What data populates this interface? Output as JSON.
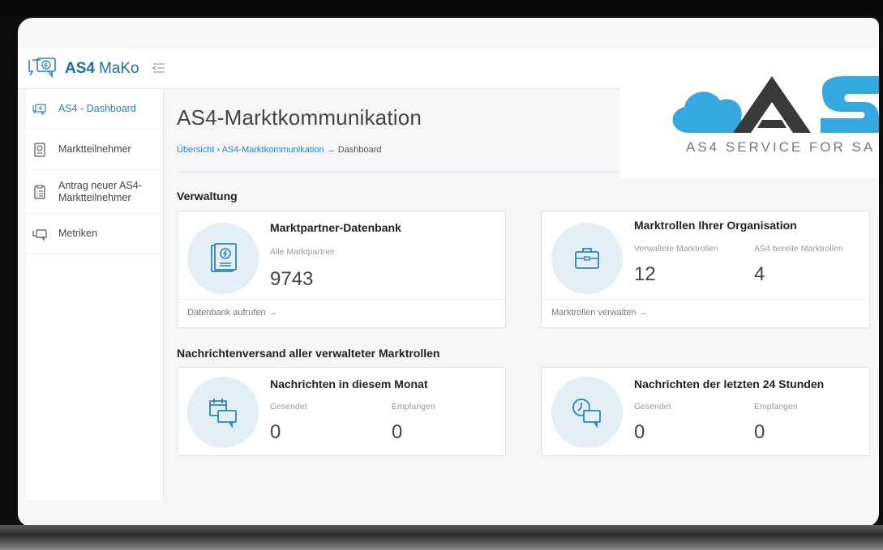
{
  "brand": {
    "as4": "AS4",
    "mako": "MaKo"
  },
  "sidebar": {
    "items": [
      {
        "label": "AS4 - Dashboard",
        "icon": "dashboard-chat-icon"
      },
      {
        "label": "Marktteilnehmer",
        "icon": "document-icon"
      },
      {
        "label": "Antrag neuer AS4-Marktteilnehmer",
        "icon": "clipboard-icon"
      },
      {
        "label": "Metriken",
        "icon": "chat-icon"
      }
    ]
  },
  "main": {
    "title": "AS4-Marktkommunikation",
    "breadcrumb": {
      "home": "Übersicht",
      "sep": " › ",
      "parent": "AS4-Marktkommunikation",
      "arrow": " → ",
      "current": "Dashboard"
    },
    "section_admin": "Verwaltung",
    "section_messages": "Nachrichtenversand aller verwalteter Marktrollen"
  },
  "cards": {
    "db": {
      "title": "Marktpartner-Datenbank",
      "sub": "Alle Marktpartner",
      "value": "9743",
      "link": "Datenbank aufrufen →"
    },
    "roles": {
      "title": "Marktrollen Ihrer Organisation",
      "sub1": "Verwaltete Marktrollen",
      "val1": "12",
      "sub2": "AS4 bereite Marktrollen",
      "val2": "4",
      "link": "Marktrollen verwalten →"
    },
    "month": {
      "title": "Nachrichten in diesem Monat",
      "sub1": "Gesendet",
      "val1": "0",
      "sub2": "Empfangen",
      "val2": "0"
    },
    "day": {
      "title": "Nachrichten der letzten 24 Stunden",
      "sub1": "Gesendet",
      "val1": "0",
      "sub2": "Empfangen",
      "val2": "0"
    }
  },
  "overlay_logo": {
    "text": "AS4 SERVICE FOR SA"
  },
  "colors": {
    "accent": "#2a86b8",
    "brand": "#1a6fa1",
    "icon_bg": "#e3eef5",
    "logo_blue": "#35a8e0",
    "logo_dark": "#3a3a3a"
  }
}
